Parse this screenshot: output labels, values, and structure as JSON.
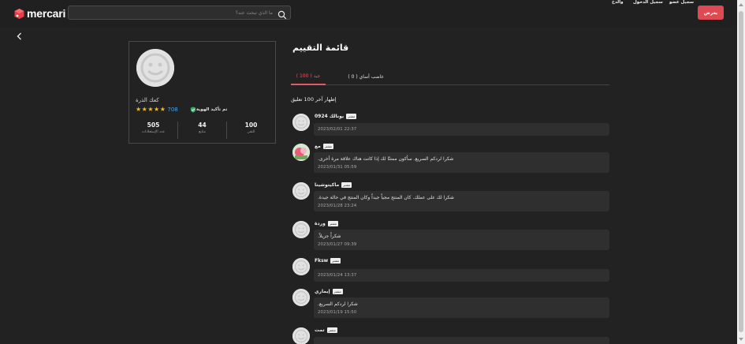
{
  "header": {
    "logo_text": "mercari",
    "search_placeholder": "ما الذي تبحث عنه؟",
    "nav": {
      "register": "سجيل عضو",
      "login": "سجيل الدخول",
      "guide": "والدخ",
      "sell": "يعرض"
    }
  },
  "profile": {
    "name": "كعك الذرة",
    "rating_count": "708",
    "verified_label": "تم تأكيد الهوية",
    "stars": 5,
    "stats": [
      {
        "value": "505",
        "label": "عدد الإستعلانات"
      },
      {
        "value": "44",
        "label": "متابع"
      },
      {
        "value": "100",
        "label": "التقي"
      }
    ]
  },
  "page": {
    "title": "قائمة التقييم",
    "tabs": [
      {
        "label": "جيد ( 100 )",
        "active": true
      },
      {
        "label": "غاضب أساي ( 0 )",
        "active": false
      }
    ],
    "showing": "إظهار آخر 100 تعليق"
  },
  "reviews": [
    {
      "name": "0924 يونالك",
      "badge": "مشتر",
      "text": "",
      "date": "2023/02/01 22:37"
    },
    {
      "name": "مع",
      "badge": "مشتر",
      "text": ".شكرا لردكم السريع. سأكون ممتنًا لك إذا كانت هناك علاقة مرة أخرى",
      "date": "2023/01/31 05:59"
    },
    {
      "name": "ماكيتوشيتا",
      "badge": "مشتر",
      "text": ".شكرا لك على عملك. كان المنتج مجياً جيداً وكان المنتج في حالة جيدة",
      "date": "2023/01/28 23:24"
    },
    {
      "name": "وردة",
      "badge": "مشتر",
      "text": ".شكراً جزيلاً",
      "date": "2023/01/27 09:39"
    },
    {
      "name": "Fksw",
      "badge": "مشتر",
      "text": "",
      "date": "2023/01/24 13:37"
    },
    {
      "name": "إيماري",
      "badge": "مشتر",
      "text": ".شكرا لردكم السريع",
      "date": "2023/01/19 15:50"
    },
    {
      "name": "تمت",
      "badge": "مشتر",
      "text": "",
      "date": ""
    }
  ],
  "colors": {
    "background": "#222222",
    "accent": "#dd4a53",
    "star": "#f5b923",
    "link_blue": "#4aa0e6"
  }
}
